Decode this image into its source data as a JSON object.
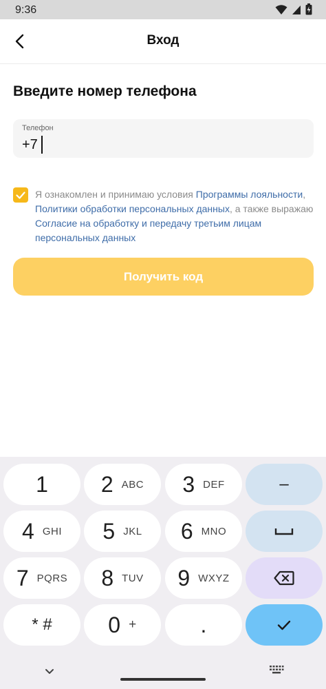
{
  "status_bar": {
    "time": "9:36"
  },
  "header": {
    "title": "Вход"
  },
  "main": {
    "heading": "Введите номер телефона",
    "phone": {
      "label": "Телефон",
      "value": "+7"
    },
    "consent": {
      "checked": true,
      "text1": "Я ознакомлен и принимаю условия ",
      "link1": "Программы лояльности",
      "text2": ", ",
      "link2": "Политики обработки персональных данных",
      "text3": ", а также выражаю ",
      "link3": "Согласие на обработку и передачу третьим лицам персональных данных"
    },
    "get_code_label": "Получить код"
  },
  "colors": {
    "accent": "#f6b81a",
    "button": "#fdd062",
    "link": "#3e6ca8"
  },
  "keyboard": {
    "k1": {
      "digit": "1",
      "letters": ""
    },
    "k2": {
      "digit": "2",
      "letters": "ABC"
    },
    "k3": {
      "digit": "3",
      "letters": "DEF"
    },
    "k4": {
      "digit": "4",
      "letters": "GHI"
    },
    "k5": {
      "digit": "5",
      "letters": "JKL"
    },
    "k6": {
      "digit": "6",
      "letters": "MNO"
    },
    "k7": {
      "digit": "7",
      "letters": "PQRS"
    },
    "k8": {
      "digit": "8",
      "letters": "TUV"
    },
    "k9": {
      "digit": "9",
      "letters": "WXYZ"
    },
    "k0": {
      "digit": "0",
      "letters": "+"
    },
    "star": "* #",
    "dot": ".",
    "minus": "–"
  }
}
